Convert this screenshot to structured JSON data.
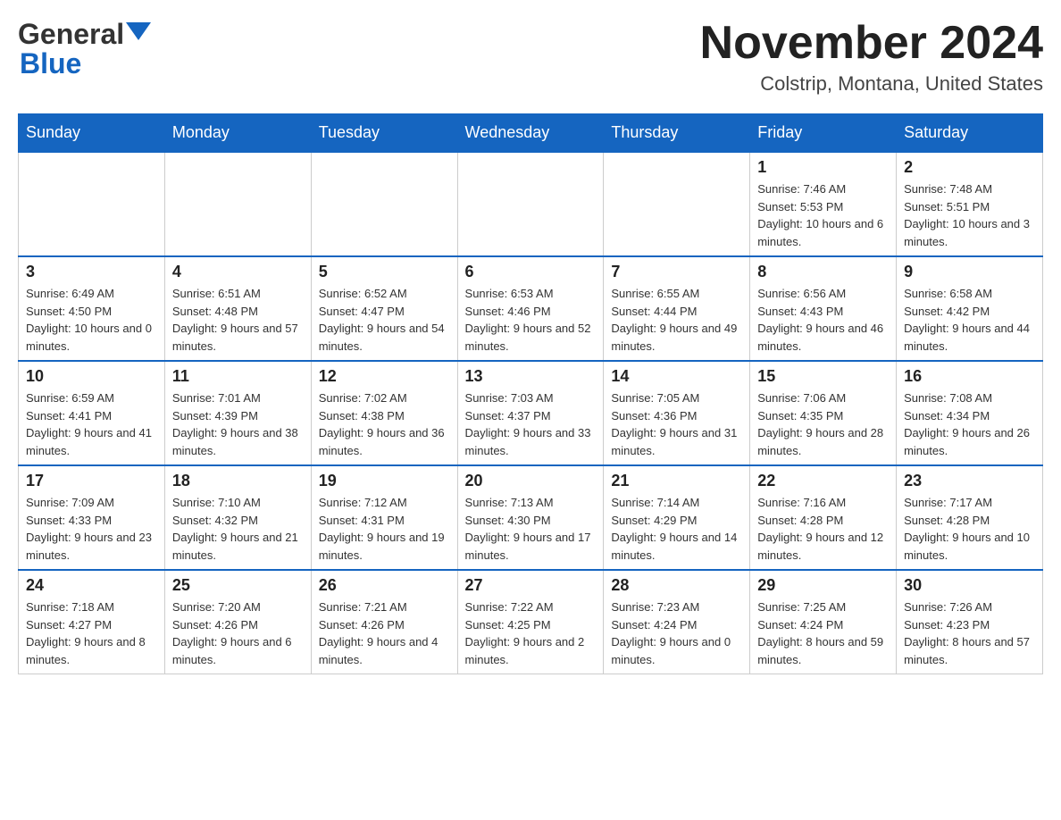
{
  "header": {
    "logo_general": "General",
    "logo_blue": "Blue",
    "month": "November 2024",
    "location": "Colstrip, Montana, United States"
  },
  "days_of_week": [
    "Sunday",
    "Monday",
    "Tuesday",
    "Wednesday",
    "Thursday",
    "Friday",
    "Saturday"
  ],
  "weeks": [
    [
      {
        "day": "",
        "info": ""
      },
      {
        "day": "",
        "info": ""
      },
      {
        "day": "",
        "info": ""
      },
      {
        "day": "",
        "info": ""
      },
      {
        "day": "",
        "info": ""
      },
      {
        "day": "1",
        "info": "Sunrise: 7:46 AM\nSunset: 5:53 PM\nDaylight: 10 hours and 6 minutes."
      },
      {
        "day": "2",
        "info": "Sunrise: 7:48 AM\nSunset: 5:51 PM\nDaylight: 10 hours and 3 minutes."
      }
    ],
    [
      {
        "day": "3",
        "info": "Sunrise: 6:49 AM\nSunset: 4:50 PM\nDaylight: 10 hours and 0 minutes."
      },
      {
        "day": "4",
        "info": "Sunrise: 6:51 AM\nSunset: 4:48 PM\nDaylight: 9 hours and 57 minutes."
      },
      {
        "day": "5",
        "info": "Sunrise: 6:52 AM\nSunset: 4:47 PM\nDaylight: 9 hours and 54 minutes."
      },
      {
        "day": "6",
        "info": "Sunrise: 6:53 AM\nSunset: 4:46 PM\nDaylight: 9 hours and 52 minutes."
      },
      {
        "day": "7",
        "info": "Sunrise: 6:55 AM\nSunset: 4:44 PM\nDaylight: 9 hours and 49 minutes."
      },
      {
        "day": "8",
        "info": "Sunrise: 6:56 AM\nSunset: 4:43 PM\nDaylight: 9 hours and 46 minutes."
      },
      {
        "day": "9",
        "info": "Sunrise: 6:58 AM\nSunset: 4:42 PM\nDaylight: 9 hours and 44 minutes."
      }
    ],
    [
      {
        "day": "10",
        "info": "Sunrise: 6:59 AM\nSunset: 4:41 PM\nDaylight: 9 hours and 41 minutes."
      },
      {
        "day": "11",
        "info": "Sunrise: 7:01 AM\nSunset: 4:39 PM\nDaylight: 9 hours and 38 minutes."
      },
      {
        "day": "12",
        "info": "Sunrise: 7:02 AM\nSunset: 4:38 PM\nDaylight: 9 hours and 36 minutes."
      },
      {
        "day": "13",
        "info": "Sunrise: 7:03 AM\nSunset: 4:37 PM\nDaylight: 9 hours and 33 minutes."
      },
      {
        "day": "14",
        "info": "Sunrise: 7:05 AM\nSunset: 4:36 PM\nDaylight: 9 hours and 31 minutes."
      },
      {
        "day": "15",
        "info": "Sunrise: 7:06 AM\nSunset: 4:35 PM\nDaylight: 9 hours and 28 minutes."
      },
      {
        "day": "16",
        "info": "Sunrise: 7:08 AM\nSunset: 4:34 PM\nDaylight: 9 hours and 26 minutes."
      }
    ],
    [
      {
        "day": "17",
        "info": "Sunrise: 7:09 AM\nSunset: 4:33 PM\nDaylight: 9 hours and 23 minutes."
      },
      {
        "day": "18",
        "info": "Sunrise: 7:10 AM\nSunset: 4:32 PM\nDaylight: 9 hours and 21 minutes."
      },
      {
        "day": "19",
        "info": "Sunrise: 7:12 AM\nSunset: 4:31 PM\nDaylight: 9 hours and 19 minutes."
      },
      {
        "day": "20",
        "info": "Sunrise: 7:13 AM\nSunset: 4:30 PM\nDaylight: 9 hours and 17 minutes."
      },
      {
        "day": "21",
        "info": "Sunrise: 7:14 AM\nSunset: 4:29 PM\nDaylight: 9 hours and 14 minutes."
      },
      {
        "day": "22",
        "info": "Sunrise: 7:16 AM\nSunset: 4:28 PM\nDaylight: 9 hours and 12 minutes."
      },
      {
        "day": "23",
        "info": "Sunrise: 7:17 AM\nSunset: 4:28 PM\nDaylight: 9 hours and 10 minutes."
      }
    ],
    [
      {
        "day": "24",
        "info": "Sunrise: 7:18 AM\nSunset: 4:27 PM\nDaylight: 9 hours and 8 minutes."
      },
      {
        "day": "25",
        "info": "Sunrise: 7:20 AM\nSunset: 4:26 PM\nDaylight: 9 hours and 6 minutes."
      },
      {
        "day": "26",
        "info": "Sunrise: 7:21 AM\nSunset: 4:26 PM\nDaylight: 9 hours and 4 minutes."
      },
      {
        "day": "27",
        "info": "Sunrise: 7:22 AM\nSunset: 4:25 PM\nDaylight: 9 hours and 2 minutes."
      },
      {
        "day": "28",
        "info": "Sunrise: 7:23 AM\nSunset: 4:24 PM\nDaylight: 9 hours and 0 minutes."
      },
      {
        "day": "29",
        "info": "Sunrise: 7:25 AM\nSunset: 4:24 PM\nDaylight: 8 hours and 59 minutes."
      },
      {
        "day": "30",
        "info": "Sunrise: 7:26 AM\nSunset: 4:23 PM\nDaylight: 8 hours and 57 minutes."
      }
    ]
  ]
}
